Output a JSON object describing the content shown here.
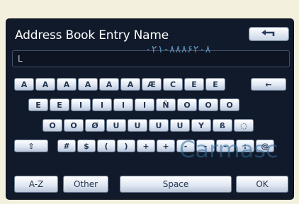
{
  "screen": {
    "title": "Address Book Entry Name",
    "input_value": "L",
    "watermark": "۰۲۱-۸۸۸۶۲۰۸",
    "watermark2": "Carmasc"
  },
  "keyboard": {
    "row1": [
      "A",
      "A",
      "A",
      "A",
      "A",
      "A",
      "Æ",
      "C",
      "E",
      "E",
      "←"
    ],
    "row2": [
      "E",
      "E",
      "I",
      "I",
      "I",
      "I",
      "Ñ",
      "O",
      "O",
      "O"
    ],
    "row3": [
      "O",
      "O",
      "Ø",
      "U",
      "U",
      "U",
      "U",
      "Y",
      "ß",
      "◌"
    ],
    "row4": [
      "⇧",
      "#",
      "$",
      "(",
      ")",
      "+",
      "+",
      "-",
      "-",
      "-",
      ":",
      "@"
    ]
  },
  "buttons": {
    "az": "A-Z",
    "other": "Other",
    "space": "Space",
    "ok": "OK"
  },
  "colors": {
    "screen_bg": "#111a2a",
    "key_text": "#23344e",
    "page_bg": "#f4f0de"
  }
}
